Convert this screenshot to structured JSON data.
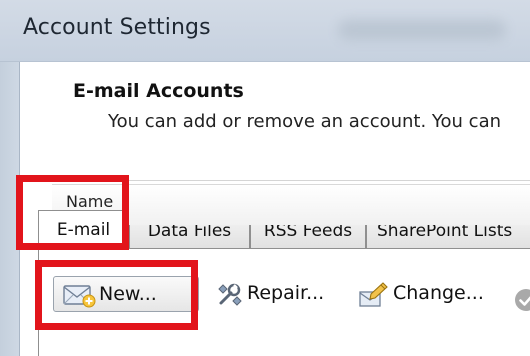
{
  "window": {
    "title": "Account Settings"
  },
  "header": {
    "title": "E-mail Accounts",
    "subtitle": "You can add or remove an account. You can"
  },
  "tabs": [
    {
      "label": "E-mail",
      "active": true
    },
    {
      "label": "Data Files",
      "active": false
    },
    {
      "label": "RSS Feeds",
      "active": false
    },
    {
      "label": "SharePoint Lists",
      "active": false
    }
  ],
  "toolbar": {
    "new_label": "New...",
    "repair_label": "Repair...",
    "change_label": "Change..."
  },
  "list": {
    "name_header": "Name"
  },
  "colors": {
    "highlight": "#e2141b",
    "titlebar": "#cbd5e2"
  },
  "icons": {
    "new": "envelope-icon",
    "repair": "wrench-icon",
    "change": "change-icon",
    "set_default": "check-circle-icon"
  }
}
